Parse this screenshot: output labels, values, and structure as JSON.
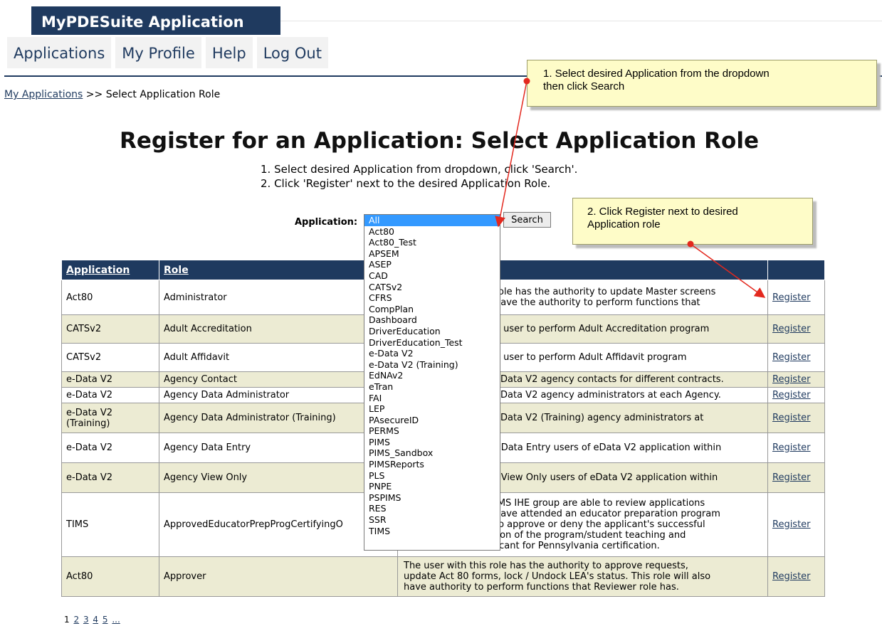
{
  "app_title": "MyPDESuite Application",
  "nav": {
    "items": [
      {
        "label": "Applications"
      },
      {
        "label": "My Profile"
      },
      {
        "label": "Help"
      },
      {
        "label": "Log Out"
      }
    ]
  },
  "breadcrumb": {
    "link": "My Applications",
    "separator": ">>",
    "current": "Select Application Role"
  },
  "page_title": "Register for an Application: Select Application Role",
  "instructions": {
    "step1": "1. Select desired Application from dropdown, click 'Search'.",
    "step2": "2. Click 'Register' next to the desired Application Role."
  },
  "filter": {
    "label": "Application:",
    "selected": "All",
    "search_label": "Search",
    "options": [
      "All",
      "Act80",
      "Act80_Test",
      "APSEM",
      "ASEP",
      "CAD",
      "CATSv2",
      "CFRS",
      "CompPlan",
      "Dashboard",
      "DriverEducation",
      "DriverEducation_Test",
      "e-Data V2",
      "e-Data V2 (Training)",
      "EdNAv2",
      "eTran",
      "FAI",
      "LEP",
      "PAsecureID",
      "PERMS",
      "PIMS",
      "PIMS_Sandbox",
      "PIMSReports",
      "PLS",
      "PNPE",
      "PSPIMS",
      "RES",
      "SSR",
      "TIMS"
    ]
  },
  "table": {
    "headers": {
      "application": "Application",
      "role": "Role"
    },
    "rows": [
      {
        "application": "Act80",
        "role": "Administrator",
        "desc1": "role has the authority to update Master screens",
        "desc2": "have the authority to perform functions that",
        "action": "Register"
      },
      {
        "application": "CATSv2",
        "role": "Adult Accreditation",
        "desc1": "e user to perform Adult Accreditation program",
        "desc2": "",
        "action": "Register"
      },
      {
        "application": "CATSv2",
        "role": "Adult Affidavit",
        "desc1": "e user to perform Adult Affidavit program",
        "desc2": "",
        "action": "Register"
      },
      {
        "application": "e-Data V2",
        "role": "Agency Contact",
        "desc1": "eData V2 agency contacts for different contracts.",
        "desc2": "",
        "action": "Register"
      },
      {
        "application": "e-Data V2",
        "role": "Agency Data Administrator",
        "desc1": "eData V2 agency administrators at each Agency.",
        "desc2": "",
        "action": "Register"
      },
      {
        "application": "e-Data V2 (Training)",
        "role": "Agency Data Administrator (Training)",
        "desc1": "eData V2 (Training) agency administrators at",
        "desc2": "",
        "action": "Register"
      },
      {
        "application": "e-Data V2",
        "role": "Agency Data Entry",
        "desc1": "f Data Entry users of eData V2 application within",
        "desc2": "",
        "action": "Register"
      },
      {
        "application": "e-Data V2",
        "role": "Agency View Only",
        "desc1": "f View Only users of eData V2 application within",
        "desc2": "",
        "action": "Register"
      },
      {
        "application": "TIMS",
        "role": "ApprovedEducatorPrepProgCertifyingO",
        "desc1": "IMS IHE group are able to review applications",
        "desc2": "have attended an educator preparation program",
        "desc3": "to approve or deny the applicant's successful",
        "desc4": "enrollment, completion of the program/student teaching and",
        "desc5": "recommend an applicant for Pennsylvania certification.",
        "action": "Register"
      },
      {
        "application": "Act80",
        "role": "Approver",
        "desc1": "The user with this role has the authority to approve requests,",
        "desc2": "update Act 80 forms, lock / Undock LEA's status. This role will also",
        "desc3": "have authority to perform functions that Reviewer role has.",
        "action": "Register"
      }
    ]
  },
  "pager": {
    "current": "1",
    "pages": [
      "2",
      "3",
      "4",
      "5",
      "..."
    ]
  },
  "callouts": {
    "one_line1": "1. Select desired Application from the dropdown",
    "one_line2": "then click Search",
    "two_line1": "2. Click Register next to desired",
    "two_line2": "Application role"
  }
}
